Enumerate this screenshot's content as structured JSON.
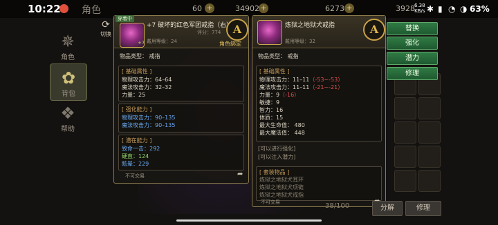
{
  "status": {
    "time": "10:22",
    "speed_value": "6.38",
    "speed_unit": "KB/s",
    "battery": "63%"
  },
  "top": {
    "title": "角色",
    "currency1": "60",
    "currency2": "34902",
    "currency3": "6273",
    "currency4": "3928"
  },
  "left_menu": {
    "switch_label": "切换",
    "items": [
      "角色",
      "背包",
      "帮助"
    ]
  },
  "left_panel": {
    "badge": "穿着中",
    "name": "+7 破坏的红色军团戒指（右）",
    "enhance": "+7",
    "score": "评分：774",
    "req_level": "戴用等级：24",
    "grade": "A",
    "bound": "角色绑定",
    "item_type": "物品类型： 戒指",
    "basic_title": "[ 基础属性 ]",
    "basic": [
      "物理攻击力：64–64",
      "魔法攻击力：32–32",
      "力量：25"
    ],
    "enh_title": "[ 强化能力 ]",
    "enh": [
      "物理攻击力：90–135",
      "魔法攻击力：90–135"
    ],
    "pot_title": "[ 潜在能力 ]",
    "pot": [
      "致命一击：292",
      "硬直：124",
      "眩晕：229"
    ],
    "trade": "不可交易"
  },
  "right_panel": {
    "name": "炼狱之地狱犬戒指",
    "req_level": "戴用等级：32",
    "grade": "A",
    "item_type": "物品类型： 戒指",
    "basic_title": "[ 基础属性 ]",
    "basic": [
      {
        "label": "物理攻击力：11–11",
        "diff": "（-53~-53）"
      },
      {
        "label": "魔法攻击力：11–11",
        "diff": "（-21~-21）"
      },
      {
        "label": "力量：9",
        "diff": "（-16）"
      },
      {
        "label": "敏捷：9",
        "diff": ""
      },
      {
        "label": "智力：16",
        "diff": ""
      },
      {
        "label": "体质：15",
        "diff": ""
      },
      {
        "label": "最大生命值：   480",
        "diff": ""
      },
      {
        "label": "最大魔法值：   448",
        "diff": ""
      }
    ],
    "can_enhance": "[可以进行强化]",
    "can_potential": "[可以注入潜力]",
    "set_title": "[ 套装物品 ]",
    "set": [
      "炼狱之地狱犬耳环",
      "炼狱之地狱犬项链",
      "炼狱之地狱犬戒指"
    ],
    "trade": "不可交易"
  },
  "actions": [
    "替换",
    "强化",
    "潜力",
    "修理"
  ],
  "bottom": {
    "capacity": "38/100",
    "btn1": "分解",
    "btn2": "修理"
  }
}
